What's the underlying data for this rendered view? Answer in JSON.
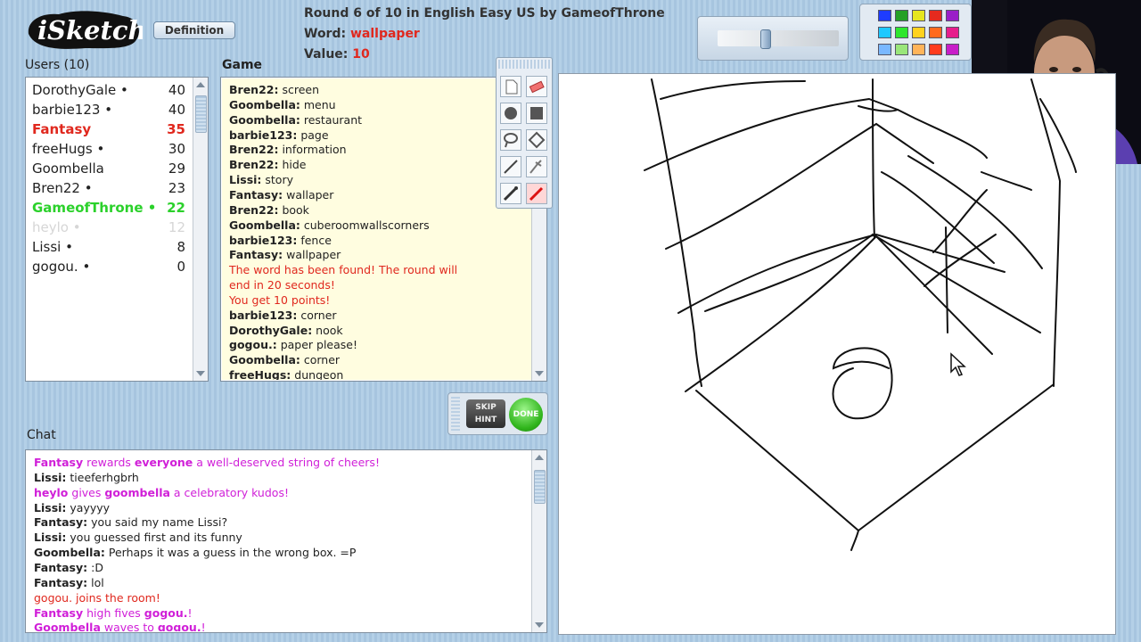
{
  "app": {
    "logo_text": "iSketch",
    "definition_label": "Definition"
  },
  "round": {
    "prefix": "Round ",
    "current": "6",
    "middle": " of 10 in English Easy US by ",
    "drawer": "GameofThrone",
    "word_label": "Word: ",
    "word": "wallpaper",
    "value_label": "Value: ",
    "value": "10"
  },
  "labels": {
    "users": "Users (10)",
    "game": "Game",
    "chat": "Chat"
  },
  "users": [
    {
      "name": "DorothyGale •",
      "score": "40",
      "color": "#222222"
    },
    {
      "name": "barbie123 •",
      "score": "40",
      "color": "#222222"
    },
    {
      "name": "Fantasy",
      "score": "35",
      "color": "#e0281e"
    },
    {
      "name": "freeHugs •",
      "score": "30",
      "color": "#222222"
    },
    {
      "name": "Goombella",
      "score": "29",
      "color": "#222222"
    },
    {
      "name": "Bren22 •",
      "score": "23",
      "color": "#222222"
    },
    {
      "name": "GameofThrone •",
      "score": "22",
      "color": "#2bd12b"
    },
    {
      "name": "heylo •",
      "score": "12",
      "color": "#d6d6d6"
    },
    {
      "name": "Lissi •",
      "score": "8",
      "color": "#222222"
    },
    {
      "name": "gogou. •",
      "score": "0",
      "color": "#222222"
    }
  ],
  "game_log": [
    {
      "who": "Bren22:",
      "text": " screen"
    },
    {
      "who": "Goombella:",
      "text": " menu"
    },
    {
      "who": "Goombella:",
      "text": " restaurant"
    },
    {
      "who": "barbie123:",
      "text": " page"
    },
    {
      "who": "Bren22:",
      "text": " information"
    },
    {
      "who": "Bren22:",
      "text": " hide"
    },
    {
      "who": "Lissi:",
      "text": " story"
    },
    {
      "who": "Fantasy:",
      "text": " wallaper"
    },
    {
      "who": "Bren22:",
      "text": " book"
    },
    {
      "who": "Goombella:",
      "text": " cuberoomwallscorners"
    },
    {
      "who": "barbie123:",
      "text": " fence"
    },
    {
      "who": "Fantasy:",
      "text": " wallpaper"
    },
    {
      "who": "",
      "text": "The word has been found! The round will",
      "system": true
    },
    {
      "who": "",
      "text": "end in 20 seconds!",
      "system": true
    },
    {
      "who": "",
      "text": "You get 10 points!",
      "system": true
    },
    {
      "who": "barbie123:",
      "text": " corner"
    },
    {
      "who": "DorothyGale:",
      "text": " nook"
    },
    {
      "who": "gogou.:",
      "text": " paper please!"
    },
    {
      "who": "Goombella:",
      "text": " corner"
    },
    {
      "who": "freeHugs:",
      "text": " dungeon"
    }
  ],
  "chat_log": [
    {
      "type": "action",
      "parts": [
        [
          "b",
          "Fantasy"
        ],
        [
          "t",
          " rewards "
        ],
        [
          "b",
          "everyone"
        ],
        [
          "t",
          " a well-deserved string of cheers!"
        ]
      ]
    },
    {
      "type": "msg",
      "who": "Lissi:",
      "text": " tieeferhgbrh"
    },
    {
      "type": "action",
      "parts": [
        [
          "b",
          "heylo"
        ],
        [
          "t",
          " gives "
        ],
        [
          "b",
          "goombella"
        ],
        [
          "t",
          " a celebratory kudos!"
        ]
      ]
    },
    {
      "type": "msg",
      "who": "Lissi:",
      "text": " yayyyy"
    },
    {
      "type": "msg",
      "who": "Fantasy:",
      "text": " you said my name Lissi?"
    },
    {
      "type": "msg",
      "who": "Lissi:",
      "text": " you guessed first and its funny"
    },
    {
      "type": "msg",
      "who": "Goombella:",
      "text": " Perhaps it was a guess in the wrong box. =P"
    },
    {
      "type": "msg",
      "who": "Fantasy:",
      "text": " :D"
    },
    {
      "type": "msg",
      "who": "Fantasy:",
      "text": " lol"
    },
    {
      "type": "system",
      "text": "gogou. joins the room!"
    },
    {
      "type": "action",
      "parts": [
        [
          "b",
          "Fantasy"
        ],
        [
          "t",
          " high fives "
        ],
        [
          "b",
          "gogou."
        ],
        [
          "t",
          "!"
        ]
      ]
    },
    {
      "type": "action",
      "parts": [
        [
          "b",
          "Goombella"
        ],
        [
          "t",
          " waves to "
        ],
        [
          "b",
          "gogou."
        ],
        [
          "t",
          "!"
        ]
      ]
    }
  ],
  "buttons": {
    "hint": "SKIP\nHINT",
    "done": "DONE"
  },
  "palette": [
    "#1e3cff",
    "#26a026",
    "#e6e61e",
    "#e52a1e",
    "#9a1ec8",
    "#1ec8ff",
    "#2ee62e",
    "#ffd21e",
    "#ff6a1e",
    "#e61e8c",
    "#7ab8ff",
    "#9ae67a",
    "#ffb45a",
    "#ff3c1e",
    "#c81ec8"
  ],
  "colors": {
    "accent_red": "#e0281e",
    "drawer_green": "#2bd12b",
    "chat_magenta": "#d01fd8",
    "game_bg": "#fffde0"
  }
}
